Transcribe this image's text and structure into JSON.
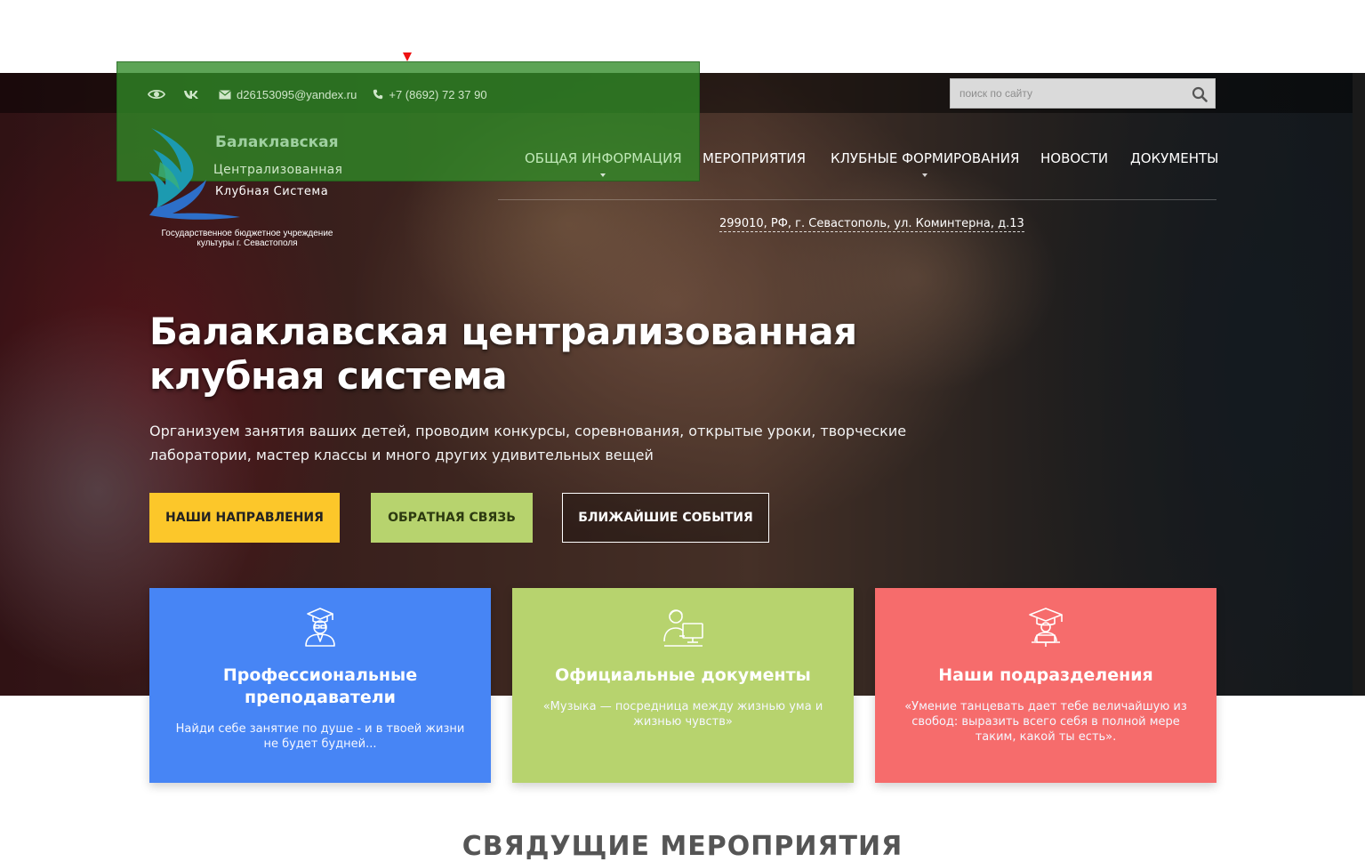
{
  "topbar": {
    "email": "d26153095@yandex.ru",
    "phone": "+7 (8692) 72 37 90",
    "icons": [
      "eye-icon",
      "vk-icon",
      "mail-icon",
      "phone-icon"
    ]
  },
  "search": {
    "placeholder": "поиск по сайту"
  },
  "logo": {
    "line1": "Балаклавская",
    "line2": "Централизованная",
    "line3": "Клубная Система",
    "subtitle": "Государственное бюджетное учреждение культуры г. Севастополя"
  },
  "nav": {
    "items": [
      {
        "label": "ОБЩАЯ ИНФОРМАЦИЯ",
        "active": true,
        "dropdown": true
      },
      {
        "label": "МЕРОПРИЯТИЯ",
        "active": false,
        "dropdown": false
      },
      {
        "label": "КЛУБНЫЕ ФОРМИРОВАНИЯ",
        "active": false,
        "dropdown": true
      },
      {
        "label": "НОВОСТИ",
        "active": false,
        "dropdown": false
      },
      {
        "label": "ДОКУМЕНТЫ",
        "active": false,
        "dropdown": false
      }
    ]
  },
  "address": "299010, РФ, г. Севастополь, ул. Коминтерна, д.13",
  "hero": {
    "title_line1": "Балаклавская централизованная",
    "title_line2": "клубная система",
    "text": "Организуем занятия ваших детей, проводим конкурсы, соревнования, открытые уроки, творческие лаборатории, мастер классы и много других удивительных вещей",
    "buttons": [
      "НАШИ НАПРАВЛЕНИЯ",
      "ОБРАТНАЯ СВЯЗЬ",
      "БЛИЖАЙШИЕ СОБЫТИЯ"
    ]
  },
  "cards": [
    {
      "title": "Профессиональные преподаватели",
      "text": "Найди себе занятие по душе - и в твоей жизни не будет будней...",
      "icon": "teacher-icon",
      "color": "#4785f5"
    },
    {
      "title": "Официальные документы",
      "text": "«Музыка — посредница между жизнью ума и жизнью чувств»",
      "icon": "student-computer-icon",
      "color": "#b7d36e"
    },
    {
      "title": "Наши подразделения",
      "text": "«Умение танцевать дает тебе величайшую из свобод: выразить всего себя в полной мере таким, какой ты есть».",
      "icon": "graduate-laptop-icon",
      "color": "#f66c6c"
    }
  ],
  "section": {
    "title": "СВЯДУЩИЕ МЕРОПРИЯТИЯ"
  },
  "colors": {
    "overlay_green": "#308a26",
    "button_yellow": "#fcc72a",
    "button_green": "#b7d36e",
    "card_blue": "#4785f5",
    "card_green": "#b7d36e",
    "card_red": "#f66c6c"
  }
}
